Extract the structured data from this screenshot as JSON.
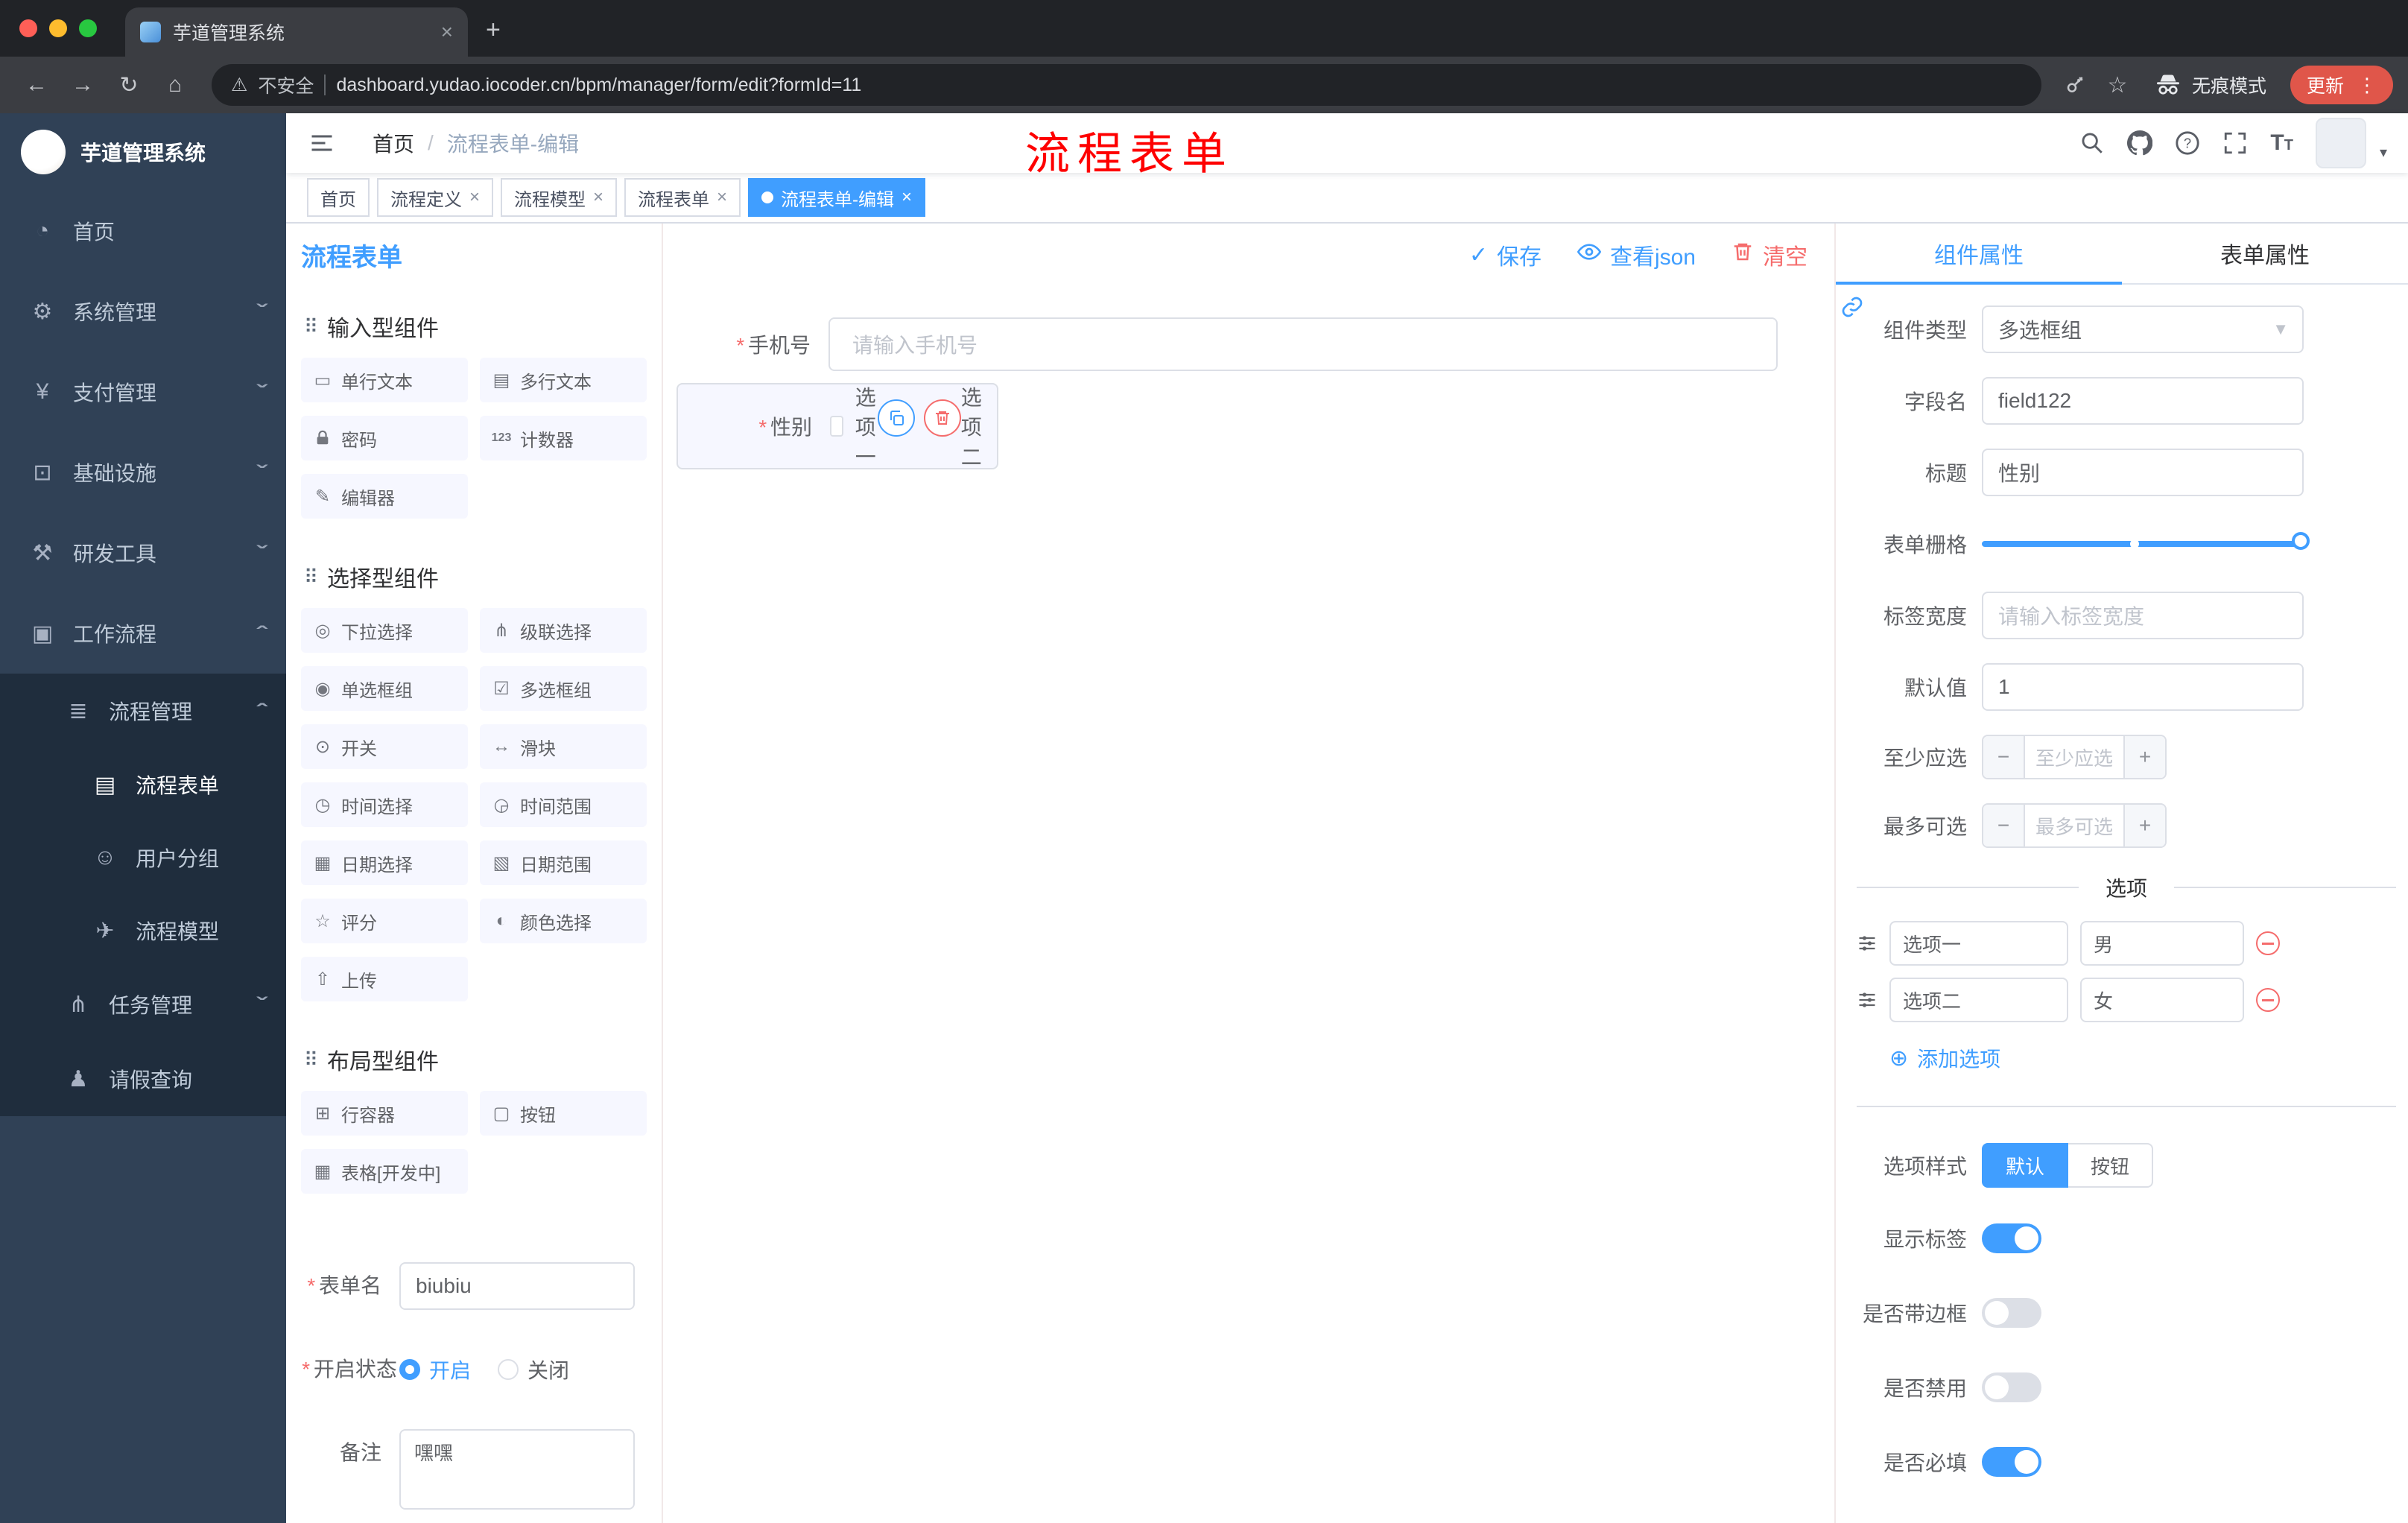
{
  "browser": {
    "tab_title": "芋道管理系统",
    "security_label": "不安全",
    "url": "dashboard.yudao.iocoder.cn/bpm/manager/form/edit?formId=11",
    "incognito_label": "无痕模式",
    "update_label": "更新"
  },
  "annotation": "流程表单",
  "sidebar": {
    "logo_title": "芋道管理系统",
    "menu": [
      {
        "label": "首页"
      },
      {
        "label": "系统管理"
      },
      {
        "label": "支付管理"
      },
      {
        "label": "基础设施"
      },
      {
        "label": "研发工具"
      },
      {
        "label": "工作流程"
      },
      {
        "label": "流程管理"
      },
      {
        "label": "流程表单"
      },
      {
        "label": "用户分组"
      },
      {
        "label": "流程模型"
      },
      {
        "label": "任务管理"
      },
      {
        "label": "请假查询"
      }
    ]
  },
  "breadcrumb": {
    "home": "首页",
    "current": "流程表单-编辑"
  },
  "tags": [
    {
      "label": "首页"
    },
    {
      "label": "流程定义"
    },
    {
      "label": "流程模型"
    },
    {
      "label": "流程表单"
    },
    {
      "label": "流程表单-编辑"
    }
  ],
  "designer": {
    "panel_title": "流程表单",
    "actions": {
      "save": "保存",
      "view_json": "查看json",
      "clear": "清空"
    },
    "palette": {
      "sections": [
        {
          "title": "输入型组件",
          "items": [
            "单行文本",
            "多行文本",
            "密码",
            "计数器",
            "编辑器"
          ]
        },
        {
          "title": "选择型组件",
          "items": [
            "下拉选择",
            "级联选择",
            "单选框组",
            "多选框组",
            "开关",
            "滑块",
            "时间选择",
            "时间范围",
            "日期选择",
            "日期范围",
            "评分",
            "颜色选择",
            "上传"
          ]
        },
        {
          "title": "布局型组件",
          "items": [
            "行容器",
            "按钮",
            "表格[开发中]"
          ]
        }
      ]
    },
    "meta": {
      "form_name": {
        "label": "表单名",
        "value": "biubiu"
      },
      "status": {
        "label": "开启状态",
        "on": "开启",
        "off": "关闭",
        "selected": "开启"
      },
      "remark": {
        "label": "备注",
        "value": "嘿嘿"
      }
    },
    "canvas": {
      "phone": {
        "label": "手机号",
        "placeholder": "请输入手机号"
      },
      "gender": {
        "label": "性别",
        "options": [
          "选项一",
          "选项二"
        ]
      }
    },
    "props": {
      "tabs": {
        "component": "组件属性",
        "form": "表单属性"
      },
      "active_tab": "组件属性",
      "component_type": {
        "label": "组件类型",
        "value": "多选框组"
      },
      "field_name": {
        "label": "字段名",
        "value": "field122"
      },
      "title": {
        "label": "标题",
        "value": "性别"
      },
      "grid": {
        "label": "表单栅格"
      },
      "label_width": {
        "label": "标签宽度",
        "placeholder": "请输入标签宽度"
      },
      "default_value": {
        "label": "默认值",
        "value": "1"
      },
      "min_select": {
        "label": "至少应选",
        "placeholder": "至少应选"
      },
      "max_select": {
        "label": "最多可选",
        "placeholder": "最多可选"
      },
      "options_title": "选项",
      "options": [
        {
          "label": "选项一",
          "value": "男"
        },
        {
          "label": "选项二",
          "value": "女"
        }
      ],
      "add_option": "添加选项",
      "option_style": {
        "label": "选项样式",
        "default": "默认",
        "button": "按钮",
        "selected": "默认"
      },
      "switches": [
        {
          "label": "显示标签",
          "on": true
        },
        {
          "label": "是否带边框",
          "on": false
        },
        {
          "label": "是否禁用",
          "on": false
        },
        {
          "label": "是否必填",
          "on": true
        }
      ]
    }
  },
  "colors": {
    "accent": "#409eff",
    "danger": "#f56c6c",
    "sidebar_bg": "#304156",
    "submenu_bg": "#1f2d3d",
    "annotation": "#fe0000",
    "update_chip": "#e0564a"
  }
}
